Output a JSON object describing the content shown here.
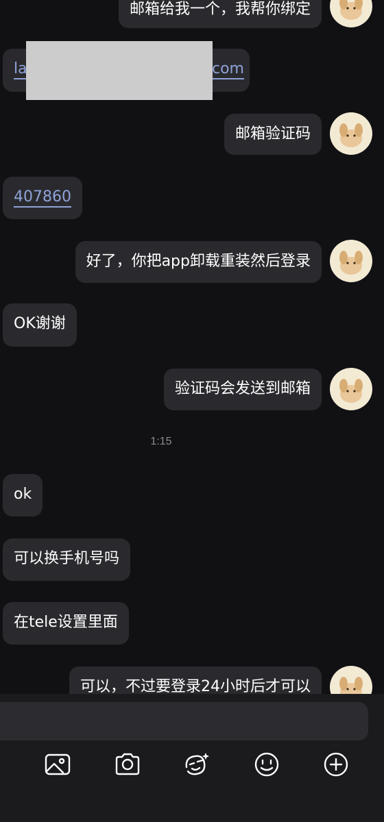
{
  "messages": [
    {
      "id": "m1",
      "text": "邮箱给我一个，我帮你绑定"
    },
    {
      "id": "m2",
      "text_start": "la",
      "text_end": "com"
    },
    {
      "id": "m3",
      "text": "邮箱验证码"
    },
    {
      "id": "m4",
      "text": "407860"
    },
    {
      "id": "m5",
      "text": "好了，你把app卸载重装然后登录"
    },
    {
      "id": "m6",
      "text": "OK谢谢"
    },
    {
      "id": "m7",
      "text": "验证码会发送到邮箱"
    },
    {
      "id": "m8",
      "text": "ok"
    },
    {
      "id": "m9",
      "text": "可以换手机号吗"
    },
    {
      "id": "m10",
      "text": "在tele设置里面"
    },
    {
      "id": "m11",
      "text": "可以，不过要登录24小时后才可以"
    }
  ],
  "timestamp": "1:15",
  "colors": {
    "background": "#111114",
    "bubble": "#2a2a2e",
    "link": "#8fa3d8",
    "avatar": "#f3ead4"
  },
  "toolbar": {
    "icons": [
      "image-icon",
      "camera-icon",
      "sticker-icon",
      "emoji-icon",
      "plus-icon"
    ]
  }
}
